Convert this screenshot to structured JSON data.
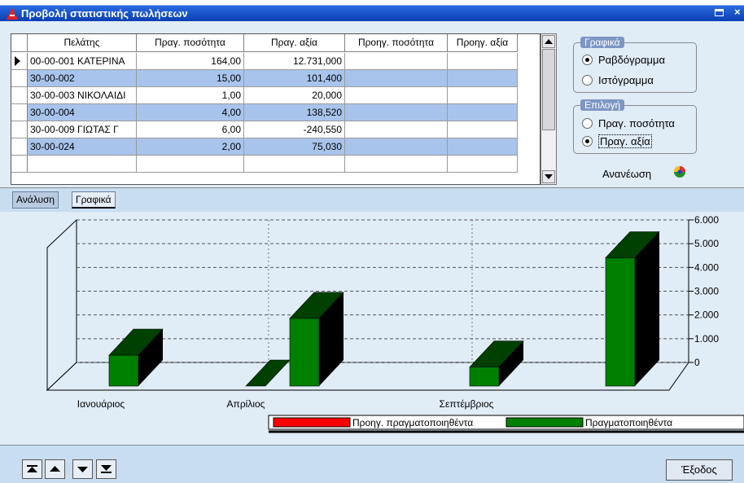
{
  "window": {
    "title": "Προβολή στατιστικής πωλήσεων",
    "icon": "app-logo-icon"
  },
  "grid": {
    "columns": [
      "Πελάτης",
      "Πραγ. ποσότητα",
      "Πραγ. αξία",
      "Προηγ. ποσότητα",
      "Προηγ. αξία"
    ],
    "rows": [
      {
        "customer": "00-00-001 ΚΑΤΕΡΙΝΑ",
        "qty": "164,00",
        "value": "12.731,000",
        "prev_qty": "",
        "prev_value": ""
      },
      {
        "customer": "30-00-002",
        "qty": "15,00",
        "value": "101,400",
        "prev_qty": "",
        "prev_value": ""
      },
      {
        "customer": "30-00-003 ΝΙΚΟΛΑΙΔΙ",
        "qty": "1,00",
        "value": "20,000",
        "prev_qty": "",
        "prev_value": ""
      },
      {
        "customer": "30-00-004",
        "qty": "4,00",
        "value": "138,520",
        "prev_qty": "",
        "prev_value": ""
      },
      {
        "customer": "30-00-009 ΓΙΩΤΑΣ Γ",
        "qty": "6,00",
        "value": "-240,550",
        "prev_qty": "",
        "prev_value": ""
      },
      {
        "customer": "30-00-024",
        "qty": "2,00",
        "value": "75,030",
        "prev_qty": "",
        "prev_value": ""
      }
    ]
  },
  "charts_group": {
    "title": "Γραφικά",
    "options": [
      "Ραβδόγραμμα",
      "Ιστόγραμμα"
    ],
    "selected": "Ραβδόγραμμα"
  },
  "selection_group": {
    "title": "Επιλογή",
    "options": [
      "Πραγ. ποσότητα",
      "Πραγ. αξία"
    ],
    "selected": "Πραγ. αξία"
  },
  "refresh_label": "Ανανέωση",
  "tabs": [
    "Ανάλυση",
    "Γραφικά"
  ],
  "active_tab": "Γραφικά",
  "chart_data": {
    "type": "bar",
    "categories": [
      "Ιανουάριος",
      "Απρίλιος",
      "Σεπτέμβριος",
      ""
    ],
    "series": [
      {
        "name": "Προηγ. πραγματοποιηθέντα",
        "color": "#ff0000",
        "values": [
          0,
          0,
          0,
          0
        ]
      },
      {
        "name": "Πραγματοποιηθέντα",
        "color": "#008000",
        "values": [
          1300,
          2850,
          800,
          5400
        ]
      }
    ],
    "yticks": [
      "0",
      "1.000",
      "2.000",
      "3.000",
      "4.000",
      "5.000",
      "6.000"
    ],
    "ylim": [
      0,
      6000
    ],
    "grid": true,
    "legend_position": "bottom-right"
  },
  "exit_label": "Έξοδος",
  "nav_buttons": [
    "first-icon",
    "prev-icon",
    "next-icon",
    "last-icon"
  ]
}
